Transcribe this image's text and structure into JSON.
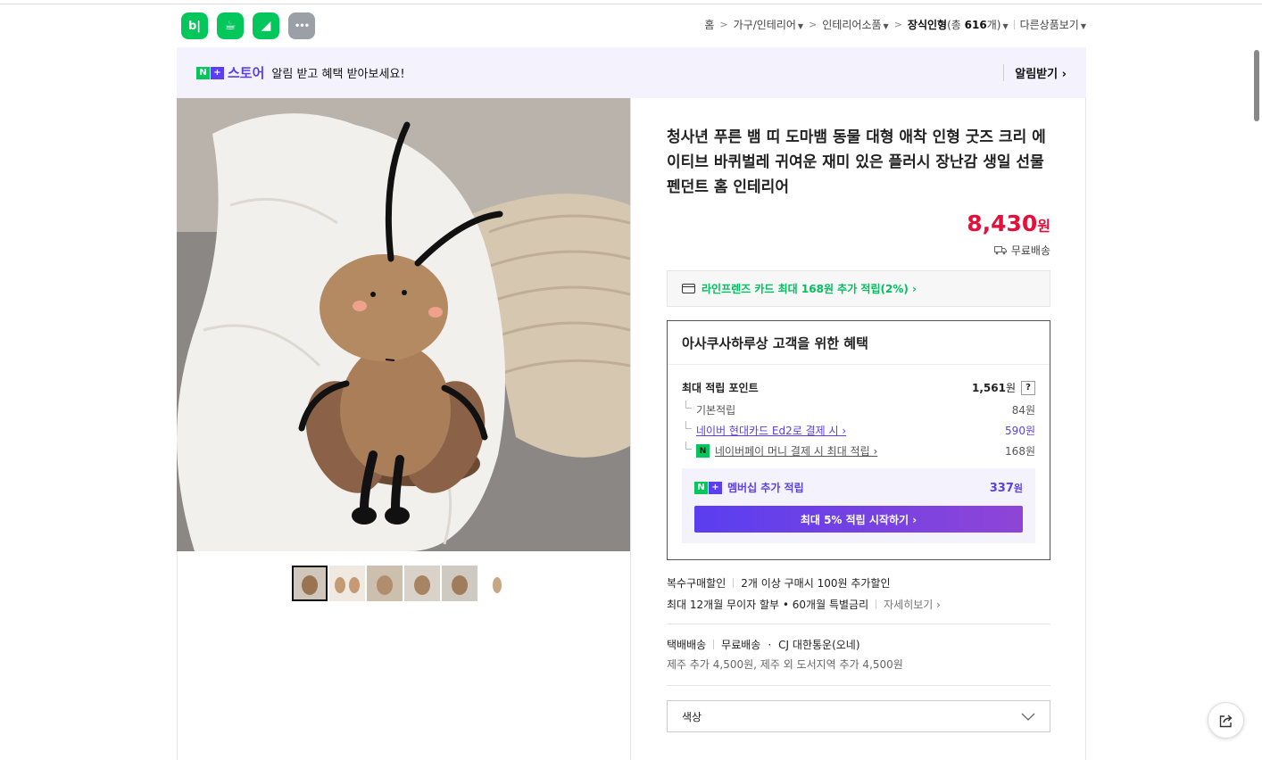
{
  "apps": [
    {
      "name": "blog-app",
      "glyph": "b|",
      "color": "#03c75a"
    },
    {
      "name": "cafe-app",
      "glyph": "☕",
      "color": "#03c75a"
    },
    {
      "name": "webtoon-app",
      "glyph": "◢",
      "color": "#03c75a"
    },
    {
      "name": "more-app",
      "glyph": "•••",
      "color": "#9aa0a6"
    }
  ],
  "breadcrumb": {
    "home": "홈",
    "cat1": "가구/인테리어",
    "cat2": "인테리어소품",
    "cat3": "장식인형",
    "cat3_count_prefix": "(총 ",
    "cat3_count": "616",
    "cat3_count_suffix": "개)",
    "more": "다른상품보기"
  },
  "banner": {
    "n_label": "N",
    "plus_label": "+",
    "store_word": "스토어",
    "text": "알림 받고 혜택 받아보세요!",
    "subscribe": "알림받기 ›"
  },
  "product": {
    "title": "청사년 푸른 뱀 띠 도마뱀 동물 대형 애착 인형 굿즈 크리 에이티브 바퀴벌레 귀여운 재미 있은 플러시 장난감 생일 선물 펜던트 홈 인테리어",
    "price": "8,430",
    "price_unit": "원",
    "shipping_badge": "무료배송"
  },
  "card_promo": "라인프렌즈 카드 최대 168원 추가 적립(2%) ›",
  "benefit": {
    "heading": "아사쿠사하루상 고객을 위한 혜택",
    "max_points_label": "최대 적립 포인트",
    "max_points_value": "1,561",
    "won": "원",
    "help": "?",
    "basic_label": "기본적립",
    "basic_value": "84원",
    "card_label": "네이버 현대카드 Ed2로 결제 시 ›",
    "card_value": "590원",
    "npay_label": "네이버페이 머니 결제 시 최대 적립 ›",
    "npay_value": "168원",
    "membership_label": "멤버십 추가 적립",
    "membership_value": "337",
    "membership_unit": "원",
    "membership_button": "최대 5% 적립 시작하기 ›"
  },
  "discount": {
    "label": "복수구매할인",
    "text": "2개 이상 구매시 100원 추가할인"
  },
  "installment": {
    "text": "최대 12개월 무이자 할부 • 60개월 특별금리",
    "more": "자세히보기 ›"
  },
  "delivery": {
    "type": "택배배송",
    "fee": "무료배송",
    "carrier": "CJ 대한통운(오네)",
    "extra": "제주 추가 4,500원, 제주 외 도서지역 추가 4,500원"
  },
  "option": {
    "label": "색상"
  },
  "colors": {
    "naver_green": "#03c75a",
    "store_purple": "#5a3ef0",
    "price_red": "#e4103b"
  }
}
